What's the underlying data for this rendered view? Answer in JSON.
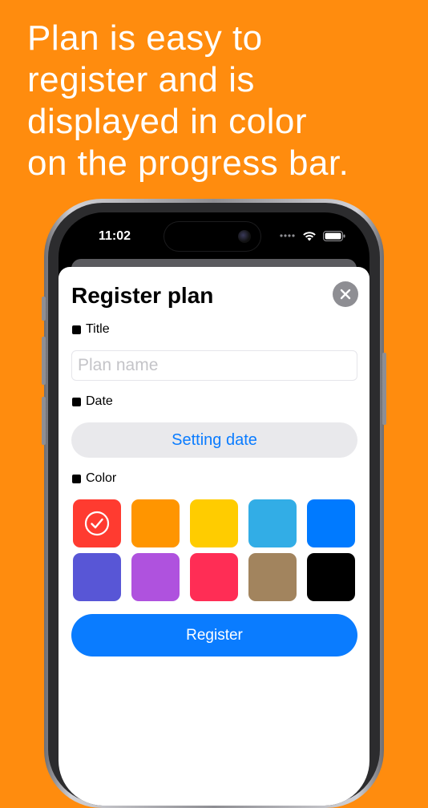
{
  "headline": "Plan is easy to\nregister and is\ndisplayed in color\non the progress bar.",
  "status_bar": {
    "time": "11:02"
  },
  "sheet": {
    "title": "Register plan",
    "title_section": {
      "label": "Title",
      "placeholder": "Plan name",
      "value": ""
    },
    "date_section": {
      "label": "Date",
      "button_label": "Setting date"
    },
    "color_section": {
      "label": "Color",
      "selected_index": 0,
      "swatches": [
        "#FF3B30",
        "#FF9500",
        "#FFCC00",
        "#32ADE6",
        "#007AFF",
        "#5856D6",
        "#AF52DE",
        "#FF2D55",
        "#A2845E",
        "#000000"
      ]
    },
    "register_label": "Register"
  },
  "colors": {
    "background": "#FF8C0E",
    "accent": "#0A7CFF"
  },
  "icons": {
    "close": "close-icon",
    "selected": "checkmark-circle-icon"
  }
}
